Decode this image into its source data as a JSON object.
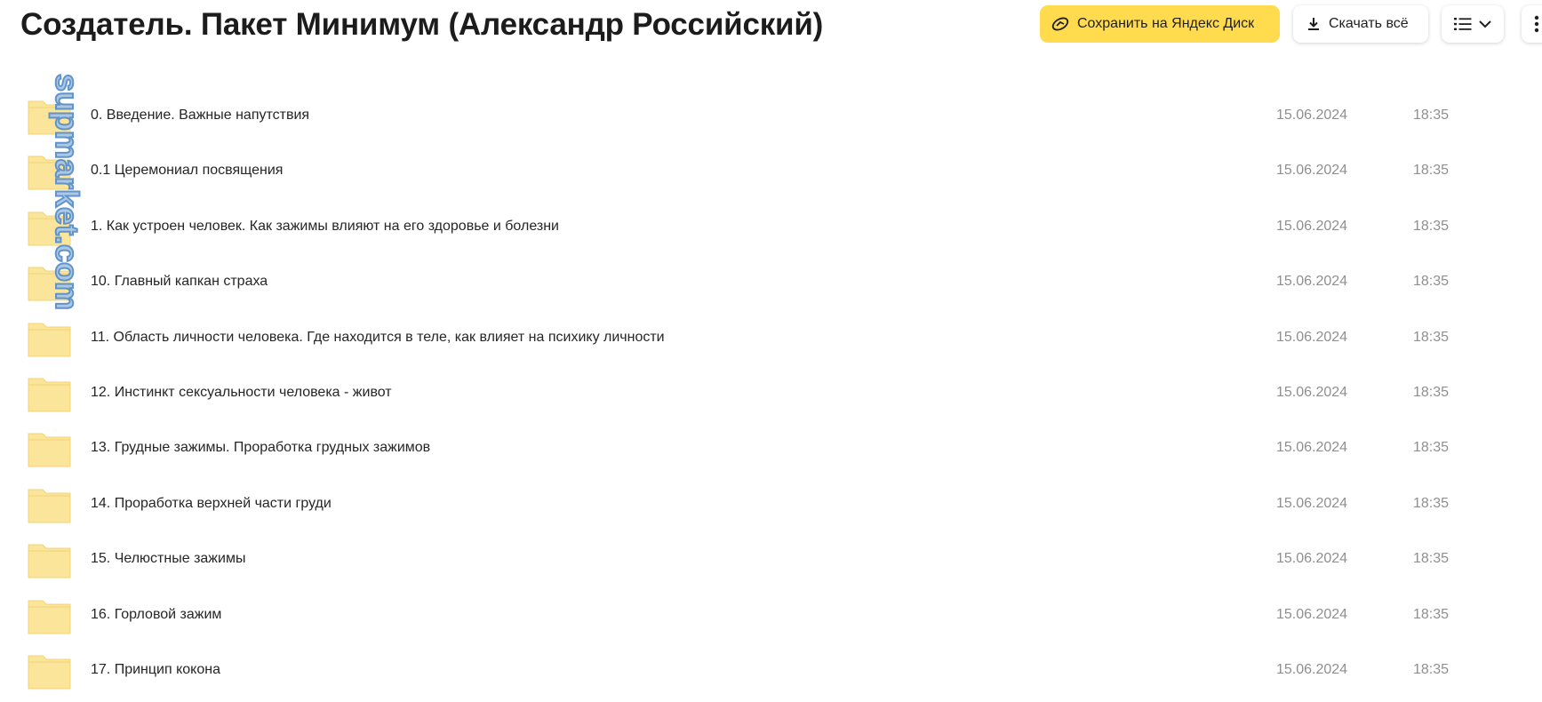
{
  "header": {
    "title": "Создатель. Пакет Минимум (Александр Российский)",
    "save_label": "Сохранить на Яндекс Диск",
    "save_icon": "disk-save-icon",
    "download_label": "Скачать всё",
    "download_icon": "download-icon",
    "view_icon": "list-view-icon",
    "more_icon": "more-vertical-icon"
  },
  "watermark": {
    "text": "supmarket.com"
  },
  "colors": {
    "accent": "#ffdb4d",
    "folder": "#fbe59b",
    "folder_stroke": "#f0d477",
    "muted_text": "#8f8f8f",
    "watermark_fill": "#a8c6e6",
    "watermark_stroke": "#5a8fc7"
  },
  "files": [
    {
      "name": "0. Введение. Важные напутствия",
      "date": "15.06.2024",
      "time": "18:35",
      "icon": "folder-icon"
    },
    {
      "name": "0.1 Церемониал посвящения",
      "date": "15.06.2024",
      "time": "18:35",
      "icon": "folder-icon"
    },
    {
      "name": "1. Как устроен человек. Как зажимы влияют на его здоровье и болезни",
      "date": "15.06.2024",
      "time": "18:35",
      "icon": "folder-icon"
    },
    {
      "name": "10. Главный капкан страха",
      "date": "15.06.2024",
      "time": "18:35",
      "icon": "folder-icon"
    },
    {
      "name": "11. Область личности человека. Где находится в теле, как влияет на психику личности",
      "date": "15.06.2024",
      "time": "18:35",
      "icon": "folder-icon"
    },
    {
      "name": "12. Инстинкт сексуальности человека - живот",
      "date": "15.06.2024",
      "time": "18:35",
      "icon": "folder-icon"
    },
    {
      "name": "13. Грудные зажимы. Проработка грудных зажимов",
      "date": "15.06.2024",
      "time": "18:35",
      "icon": "folder-icon"
    },
    {
      "name": "14. Проработка верхней части груди",
      "date": "15.06.2024",
      "time": "18:35",
      "icon": "folder-icon"
    },
    {
      "name": "15. Челюстные зажимы",
      "date": "15.06.2024",
      "time": "18:35",
      "icon": "folder-icon"
    },
    {
      "name": "16. Горловой зажим",
      "date": "15.06.2024",
      "time": "18:35",
      "icon": "folder-icon"
    },
    {
      "name": "17. Принцип кокона",
      "date": "15.06.2024",
      "time": "18:35",
      "icon": "folder-icon"
    }
  ]
}
